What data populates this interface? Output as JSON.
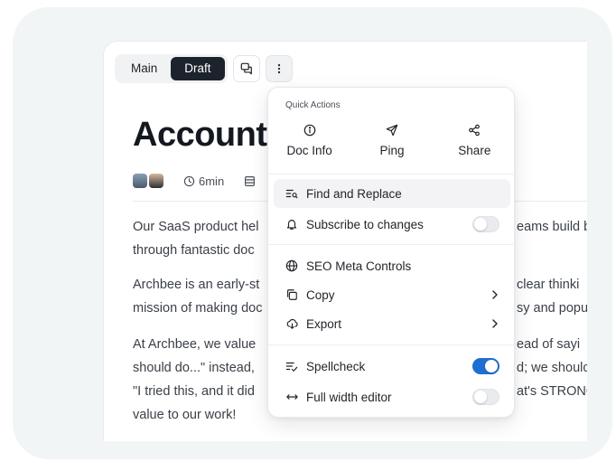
{
  "toolbar": {
    "tabs": [
      {
        "label": "Main"
      },
      {
        "label": "Draft"
      }
    ],
    "active_tab": "Draft",
    "comment_icon": "comment-icon",
    "more_icon": "more-vertical-icon"
  },
  "document": {
    "title": "Account",
    "read_time": "6min",
    "paragraphs": [
      {
        "line1": "Our SaaS product hel",
        "line1_right": "eams build b",
        "line2": "through fantastic doc"
      },
      {
        "line1": "Archbee is an early-st",
        "line1_right": "clear thinki",
        "line2": "mission of making doc",
        "line2_right": "sy and popu"
      },
      {
        "line1": "At Archbee, we value",
        "line1_right": "ead of sayi",
        "line2": "should do...\" instead, ",
        "line2_right": "d; we shoulc",
        "line3": "\"I tried this, and it did",
        "line3_right": "at's STRONG",
        "line4": "value to our work!"
      }
    ]
  },
  "menu": {
    "heading": "Quick Actions",
    "quick_actions": [
      {
        "label": "Doc Info",
        "icon": "info-icon"
      },
      {
        "label": "Ping",
        "icon": "send-icon"
      },
      {
        "label": "Share",
        "icon": "share-icon"
      }
    ],
    "items": [
      {
        "label": "Find and Replace",
        "icon": "find-replace-icon"
      },
      {
        "label": "Subscribe to changes",
        "icon": "bell-icon",
        "toggle": false
      },
      {
        "label": "SEO Meta Controls",
        "icon": "globe-icon"
      },
      {
        "label": "Copy",
        "icon": "copy-icon",
        "submenu": true
      },
      {
        "label": "Export",
        "icon": "cloud-download-icon",
        "submenu": true
      },
      {
        "label": "Spellcheck",
        "icon": "spellcheck-icon",
        "toggle": true
      },
      {
        "label": "Full width editor",
        "icon": "arrows-horizontal-icon",
        "toggle": false
      }
    ]
  },
  "colors": {
    "toggle_on": "#1f6fd1",
    "active_tab_bg": "#1d232c"
  }
}
